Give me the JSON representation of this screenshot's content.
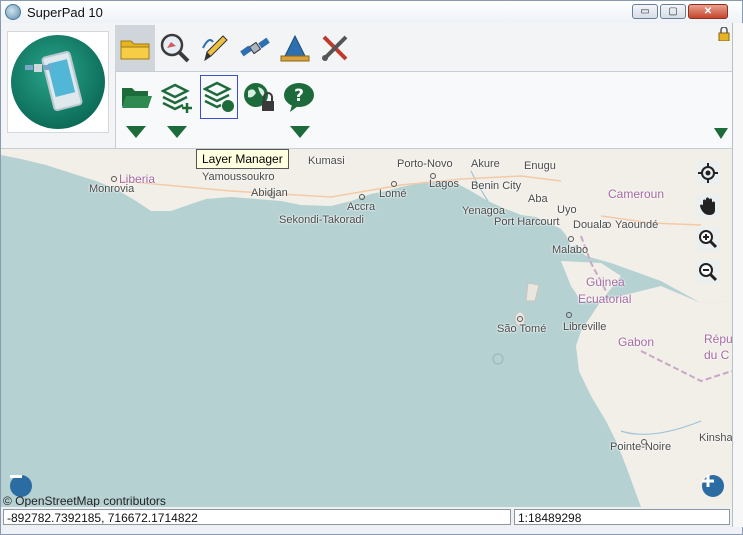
{
  "window": {
    "title": "SuperPad 10",
    "buttons": {
      "minimize": "▭",
      "maximize": "▢",
      "close": "✕"
    }
  },
  "ribbon": {
    "tabs": [
      {
        "icon": "folder-icon"
      },
      {
        "icon": "search-map-icon"
      },
      {
        "icon": "pencil-icon"
      },
      {
        "icon": "satellite-icon"
      },
      {
        "icon": "survey-ruler-icon"
      },
      {
        "icon": "tools-icon"
      }
    ],
    "tools": [
      {
        "icon": "open-folder-icon"
      },
      {
        "icon": "add-layer-icon"
      },
      {
        "icon": "layer-manager-icon"
      },
      {
        "icon": "globe-lock-icon"
      },
      {
        "icon": "help-icon"
      }
    ],
    "tooltip": "Layer Manager"
  },
  "map": {
    "labels": [
      {
        "id": "liberia",
        "text": "Liberia"
      },
      {
        "id": "monrovia",
        "text": "Monrovia"
      },
      {
        "id": "yamoussoukro",
        "text": "Yamoussoukro"
      },
      {
        "id": "abidjan",
        "text": "Abidjan"
      },
      {
        "id": "kumasi",
        "text": "Kumasi"
      },
      {
        "id": "accra",
        "text": "Accra"
      },
      {
        "id": "sekondi",
        "text": "Sekondi-Takoradi"
      },
      {
        "id": "porto_novo",
        "text": "Porto-Novo"
      },
      {
        "id": "lome",
        "text": "Lomé"
      },
      {
        "id": "lagos",
        "text": "Lagos"
      },
      {
        "id": "akure",
        "text": "Akure"
      },
      {
        "id": "enugu",
        "text": "Enugu"
      },
      {
        "id": "benin_city",
        "text": "Benin City"
      },
      {
        "id": "aba",
        "text": "Aba"
      },
      {
        "id": "yenagoa",
        "text": "Yenagoa"
      },
      {
        "id": "uyo",
        "text": "Uyo"
      },
      {
        "id": "port_harcourt",
        "text": "Port Harcourt"
      },
      {
        "id": "douala",
        "text": "Douala"
      },
      {
        "id": "yaounde",
        "text": "Yaoundé"
      },
      {
        "id": "cameroun",
        "text": "Cameroun"
      },
      {
        "id": "malabo",
        "text": "Malabo"
      },
      {
        "id": "guinea",
        "text": "Guinea"
      },
      {
        "id": "ecuatorial",
        "text": "Ecuatorial"
      },
      {
        "id": "sao_tome",
        "text": "São Tomé"
      },
      {
        "id": "libreville",
        "text": "Libreville"
      },
      {
        "id": "gabon",
        "text": "Gabon"
      },
      {
        "id": "repu",
        "text": "Répu"
      },
      {
        "id": "du_c",
        "text": "du C"
      },
      {
        "id": "pointe_noire",
        "text": "Pointe-Noire"
      },
      {
        "id": "kinsha",
        "text": "Kinsha"
      }
    ],
    "attribution": "© OpenStreetMap contributors",
    "map_tools": [
      "locate-icon",
      "pan-hand-icon",
      "zoom-in-icon",
      "zoom-out-icon"
    ]
  },
  "status": {
    "coordinates": "-892782.7392185, 716672.1714822",
    "scale": "1:18489298"
  },
  "colors": {
    "water": "#b6d1d2",
    "land": "#f2efe9",
    "accent_green": "#1d6b3b",
    "tooltip_bg": "#ffffe1"
  }
}
